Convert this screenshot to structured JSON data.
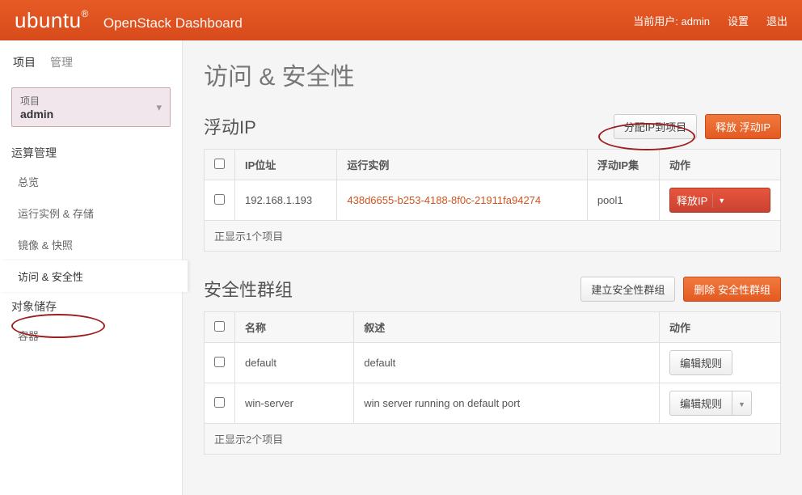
{
  "header": {
    "brand": "ubuntu",
    "brand_symbol": "®",
    "product": "OpenStack Dashboard",
    "current_user_label": "当前用户:",
    "current_user": "admin",
    "settings": "设置",
    "logout": "退出"
  },
  "sidebar": {
    "tabs": [
      {
        "label": "项目",
        "active": true
      },
      {
        "label": "管理",
        "active": false
      }
    ],
    "project_label": "项目",
    "project_name": "admin",
    "compute_heading": "运算管理",
    "compute_items": [
      {
        "label": "总览"
      },
      {
        "label": "运行实例 & 存储"
      },
      {
        "label": "镜像 & 快照"
      },
      {
        "label": "访问 & 安全性",
        "active": true
      }
    ],
    "storage_heading": "对象储存",
    "storage_items": [
      {
        "label": "容器"
      }
    ]
  },
  "page_title": "访问 & 安全性",
  "floating": {
    "title": "浮动IP",
    "allocate_btn": "分配IP到项目",
    "release_btn": "释放 浮动IP",
    "headers": {
      "ip": "IP位址",
      "instance": "运行实例",
      "pool": "浮动IP集",
      "actions": "动作"
    },
    "rows": [
      {
        "ip": "192.168.1.193",
        "instance": "438d6655-b253-4188-8f0c-21911fa94274",
        "pool": "pool1",
        "action": "释放IP"
      }
    ],
    "footer": "正显示1个项目"
  },
  "secgroups": {
    "title": "安全性群组",
    "create_btn": "建立安全性群组",
    "delete_btn": "删除 安全性群组",
    "headers": {
      "name": "名称",
      "desc": "叙述",
      "actions": "动作"
    },
    "rows": [
      {
        "name": "default",
        "desc": "default",
        "action": "编辑规则",
        "split": false
      },
      {
        "name": "win-server",
        "desc": "win server running on default port",
        "action": "编辑规则",
        "split": true
      }
    ],
    "footer": "正显示2个项目"
  }
}
